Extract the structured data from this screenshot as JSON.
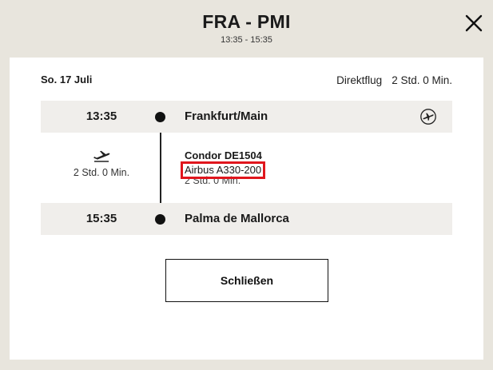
{
  "header": {
    "route": "FRA - PMI",
    "times": "13:35 - 15:35"
  },
  "card": {
    "date": "So. 17 Juli",
    "flight_type": "Direktflug",
    "total_duration": "2 Std. 0 Min."
  },
  "departure": {
    "time": "13:35",
    "place": "Frankfurt/Main",
    "icon": "airline-logo-icon"
  },
  "segment": {
    "duration_icon": "airplane-takeoff-icon",
    "duration": "2 Std. 0 Min.",
    "flight_number": "Condor DE1504",
    "aircraft": "Airbus A330-200",
    "flight_duration": "2 Std. 0 Min.",
    "highlight_color": "#e0161d"
  },
  "arrival": {
    "time": "15:35",
    "place": "Palma de Mallorca"
  },
  "actions": {
    "close_label": "Schließen"
  }
}
